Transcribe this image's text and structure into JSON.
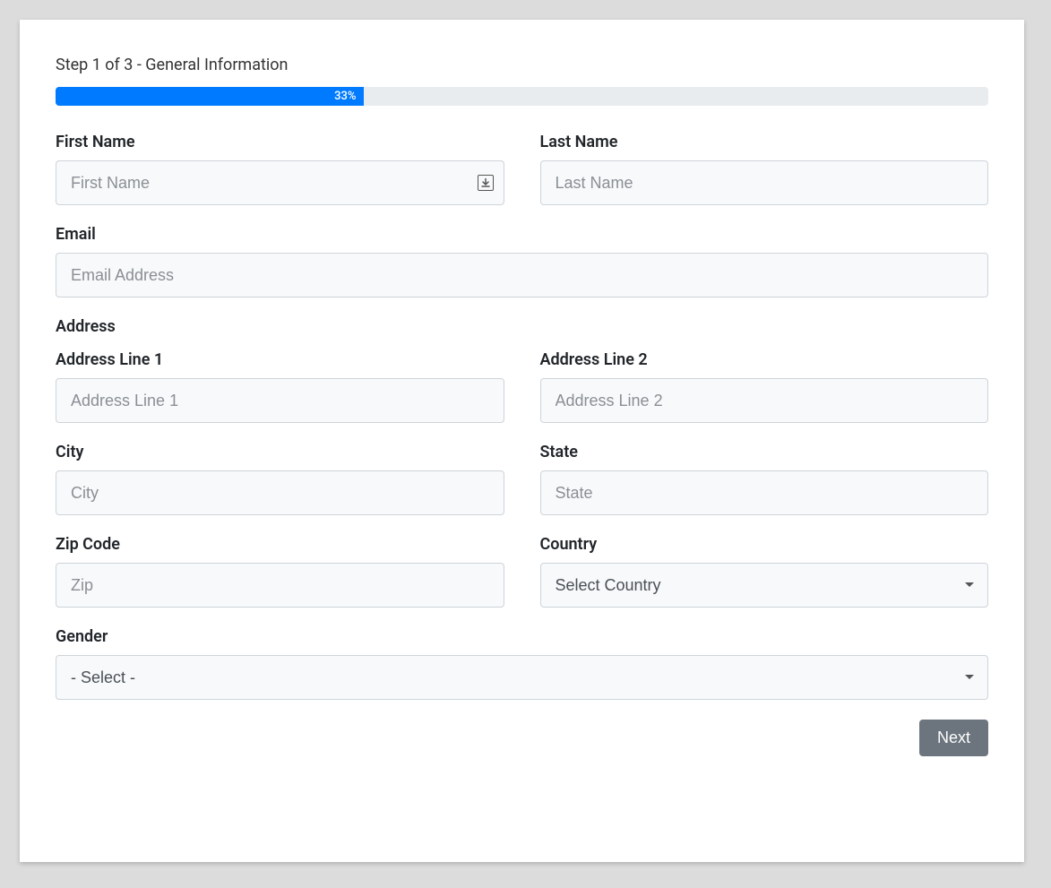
{
  "stepTitle": "Step 1 of 3 - General Information",
  "progress": {
    "percent": 33,
    "label": "33%"
  },
  "labels": {
    "firstName": "First Name",
    "lastName": "Last Name",
    "email": "Email",
    "addressSection": "Address",
    "address1": "Address Line 1",
    "address2": "Address Line 2",
    "city": "City",
    "state": "State",
    "zip": "Zip Code",
    "country": "Country",
    "gender": "Gender"
  },
  "placeholders": {
    "firstName": "First Name",
    "lastName": "Last Name",
    "email": "Email Address",
    "address1": "Address Line 1",
    "address2": "Address Line 2",
    "city": "City",
    "state": "State",
    "zip": "Zip"
  },
  "selects": {
    "countryDefault": "Select Country",
    "genderDefault": "- Select -"
  },
  "buttons": {
    "next": "Next"
  },
  "colors": {
    "progressBar": "#007bff",
    "progressBg": "#e9ecef",
    "inputBg": "#f8f9fa",
    "inputBorder": "#ced4da",
    "btnSecondary": "#6c757d"
  }
}
